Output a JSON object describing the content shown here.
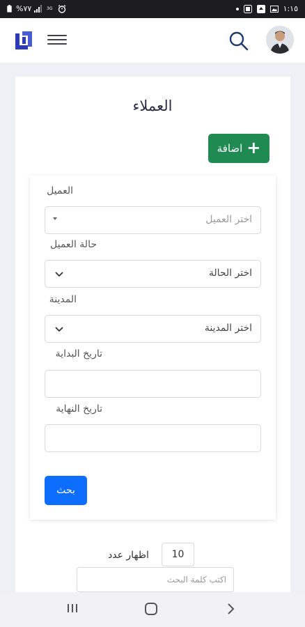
{
  "status_bar": {
    "battery": "%٧٧",
    "time": "١:١٥"
  },
  "header": {
    "logo_icon": "brand-logo-icon",
    "menu_icon": "hamburger-icon",
    "search_icon": "search-icon",
    "avatar_icon": "user-avatar"
  },
  "page": {
    "title": "العملاء"
  },
  "toolbar": {
    "add_label": "اضافة"
  },
  "filters": {
    "client_label": "العميل",
    "client_placeholder": "اختر العميل",
    "status_label": "حالة العميل",
    "status_value": "اختر الحالة",
    "city_label": "المدينة",
    "city_value": "اختر المدينة",
    "start_date_label": "تاريخ البداية",
    "start_date_value": "",
    "end_date_label": "تاريخ النهاية",
    "end_date_value": "",
    "search_label": "بحث"
  },
  "table_controls": {
    "show_label": "اظهار عدد",
    "show_value": "10",
    "keyword_placeholder": "اكتب كلمة البحث"
  },
  "colors": {
    "primary": "#0d6efd",
    "success": "#1f8a52",
    "brand": "#2f3bb6"
  }
}
